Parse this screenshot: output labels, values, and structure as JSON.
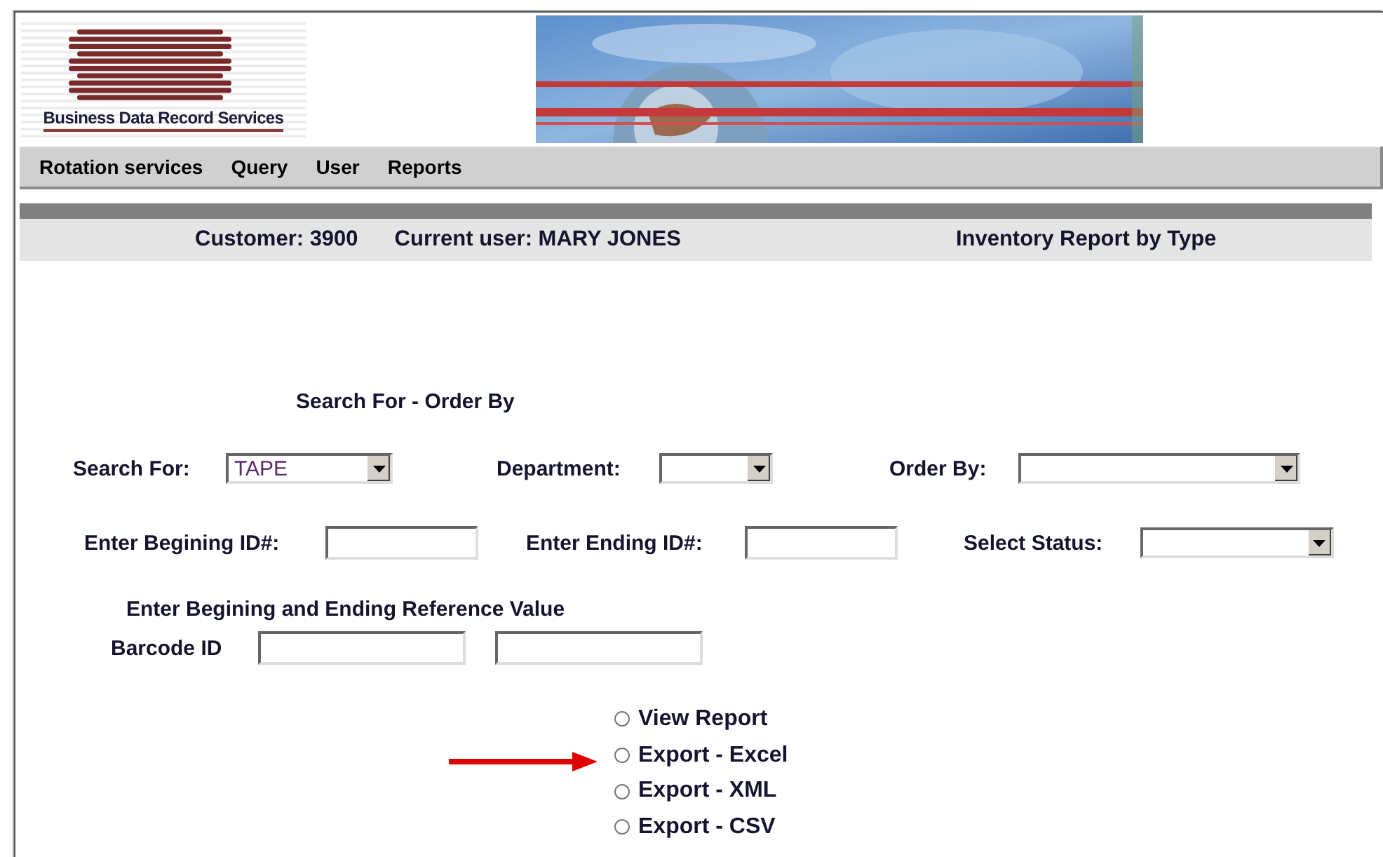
{
  "logo": {
    "caption": "Business Data Record Services"
  },
  "menu": [
    {
      "label": "Rotation services"
    },
    {
      "label": "Query"
    },
    {
      "label": "User"
    },
    {
      "label": "Reports"
    }
  ],
  "info_bar": {
    "customer": "Customer: 3900",
    "current_user": "Current user: MARY JONES",
    "report_title": "Inventory Report by Type"
  },
  "form": {
    "section_title": "Search For - Order By",
    "rows": [
      [
        {
          "kind": "select",
          "label": "Search For:",
          "value": "TAPE"
        },
        {
          "kind": "select",
          "label": "Department:"
        },
        {
          "kind": "select",
          "label": "Order By:"
        }
      ],
      [
        {
          "kind": "input",
          "label": "Enter Begining ID#:"
        },
        {
          "kind": "input",
          "label": "Enter Ending ID#:"
        },
        {
          "kind": "select",
          "label": "Select Status:"
        }
      ]
    ],
    "reference_title": "Enter Begining and Ending Reference Value",
    "barcode_label": "Barcode ID",
    "output_options": [
      {
        "label": "View Report",
        "selected": false
      },
      {
        "label": "Export - Excel",
        "selected": false
      },
      {
        "label": "Export - XML",
        "selected": false
      },
      {
        "label": "Export - CSV",
        "selected": false
      }
    ]
  }
}
